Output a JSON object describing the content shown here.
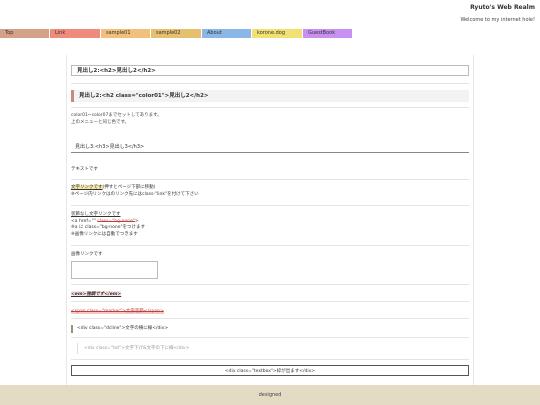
{
  "header": {
    "title": "Ryuto's Web Realm",
    "tagline": "Welcome to my internet hole!"
  },
  "nav": [
    {
      "label": "Top",
      "color": "#d4a088",
      "width": 50
    },
    {
      "label": "Link",
      "color": "#f08a7a",
      "width": 51
    },
    {
      "label": "sample01",
      "color": "#f2c07a",
      "width": 50
    },
    {
      "label": "sample02",
      "color": "#e6c070",
      "width": 51
    },
    {
      "label": "About",
      "color": "#8ab6e8",
      "width": 50
    },
    {
      "label": "korone.dog",
      "color": "#f2e070",
      "width": 51
    },
    {
      "label": "GuestBook",
      "color": "#c890f0",
      "width": 50
    }
  ],
  "content": {
    "h2_plain": "見出し2:<h2>見出し2</h2>",
    "h2_color": "見出し2:<h2 class=\"color01\">見出し2</h2>",
    "color_note_1": "color01~color07までセットしてあります。",
    "color_note_2": "上のメニューと同じ色です。",
    "h3": "見出し3:<h3>見出し3</h3>",
    "text": "テキストです",
    "link_hl": "文字リンクです",
    "link_rest": "(押すとページ下部に移動)",
    "link_note": "※ページ内リンクはのリンク先にはclass-\"link\"を付けて下さい",
    "bg_none": "装飾なし文字リンクです",
    "a_prefix": "<a  href=\"\" ",
    "a_class": "class=\"bg-none\"",
    "a_suffix": ">",
    "bg_note_1": "※a に class=\"bg-none\"をつけます",
    "bg_note_2": "※画像リンクには自動でつきます",
    "img_link": "画像リンクです",
    "em": "<em>強調です</em>",
    "marker": "<span class=\"marker\">文字装飾</span>",
    "dcline": "<div class=\"dcline\">文字の横に線</div>",
    "txt1": "<div class=\"txt\">文字下げ&文字の下に線</div>",
    "textbox": "<div class=\"textbox\">枠が出ます</div>"
  },
  "footer": {
    "text": "designed"
  }
}
